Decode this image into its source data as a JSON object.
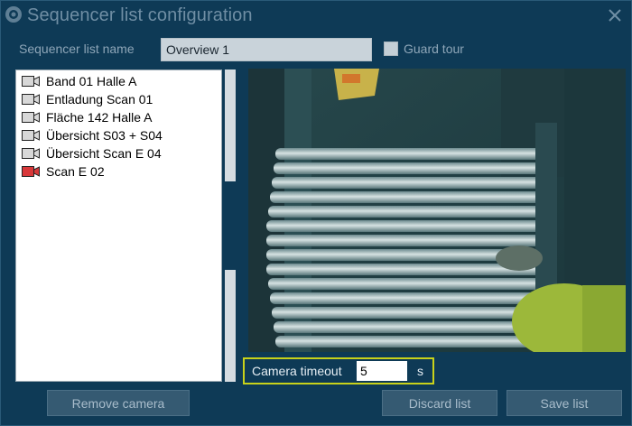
{
  "window": {
    "title": "Sequencer list configuration",
    "close_icon": "close-icon",
    "app_icon": "camera-app-icon"
  },
  "form": {
    "name_label": "Sequencer list name",
    "name_value": "Overview 1",
    "guard_tour_label": "Guard tour",
    "guard_tour_checked": false
  },
  "camera_list": {
    "items": [
      {
        "label": "Band 01 Halle A",
        "icon": "camera-icon",
        "state": "normal"
      },
      {
        "label": "Entladung Scan 01",
        "icon": "camera-icon",
        "state": "normal"
      },
      {
        "label": "Fläche 142 Halle A",
        "icon": "camera-icon",
        "state": "normal"
      },
      {
        "label": "Übersicht S03 + S04",
        "icon": "camera-icon",
        "state": "normal"
      },
      {
        "label": "Übersicht Scan E 04",
        "icon": "camera-icon",
        "state": "normal"
      },
      {
        "label": "Scan E 02",
        "icon": "camera-icon",
        "state": "alert"
      }
    ]
  },
  "timeout": {
    "label": "Camera timeout",
    "value": "5",
    "unit": "s",
    "highlight_color": "#c8d21a"
  },
  "buttons": {
    "remove": "Remove camera",
    "discard": "Discard list",
    "save": "Save list"
  },
  "colors": {
    "background": "#0e3a56",
    "alert_camera": "#c8282a"
  }
}
